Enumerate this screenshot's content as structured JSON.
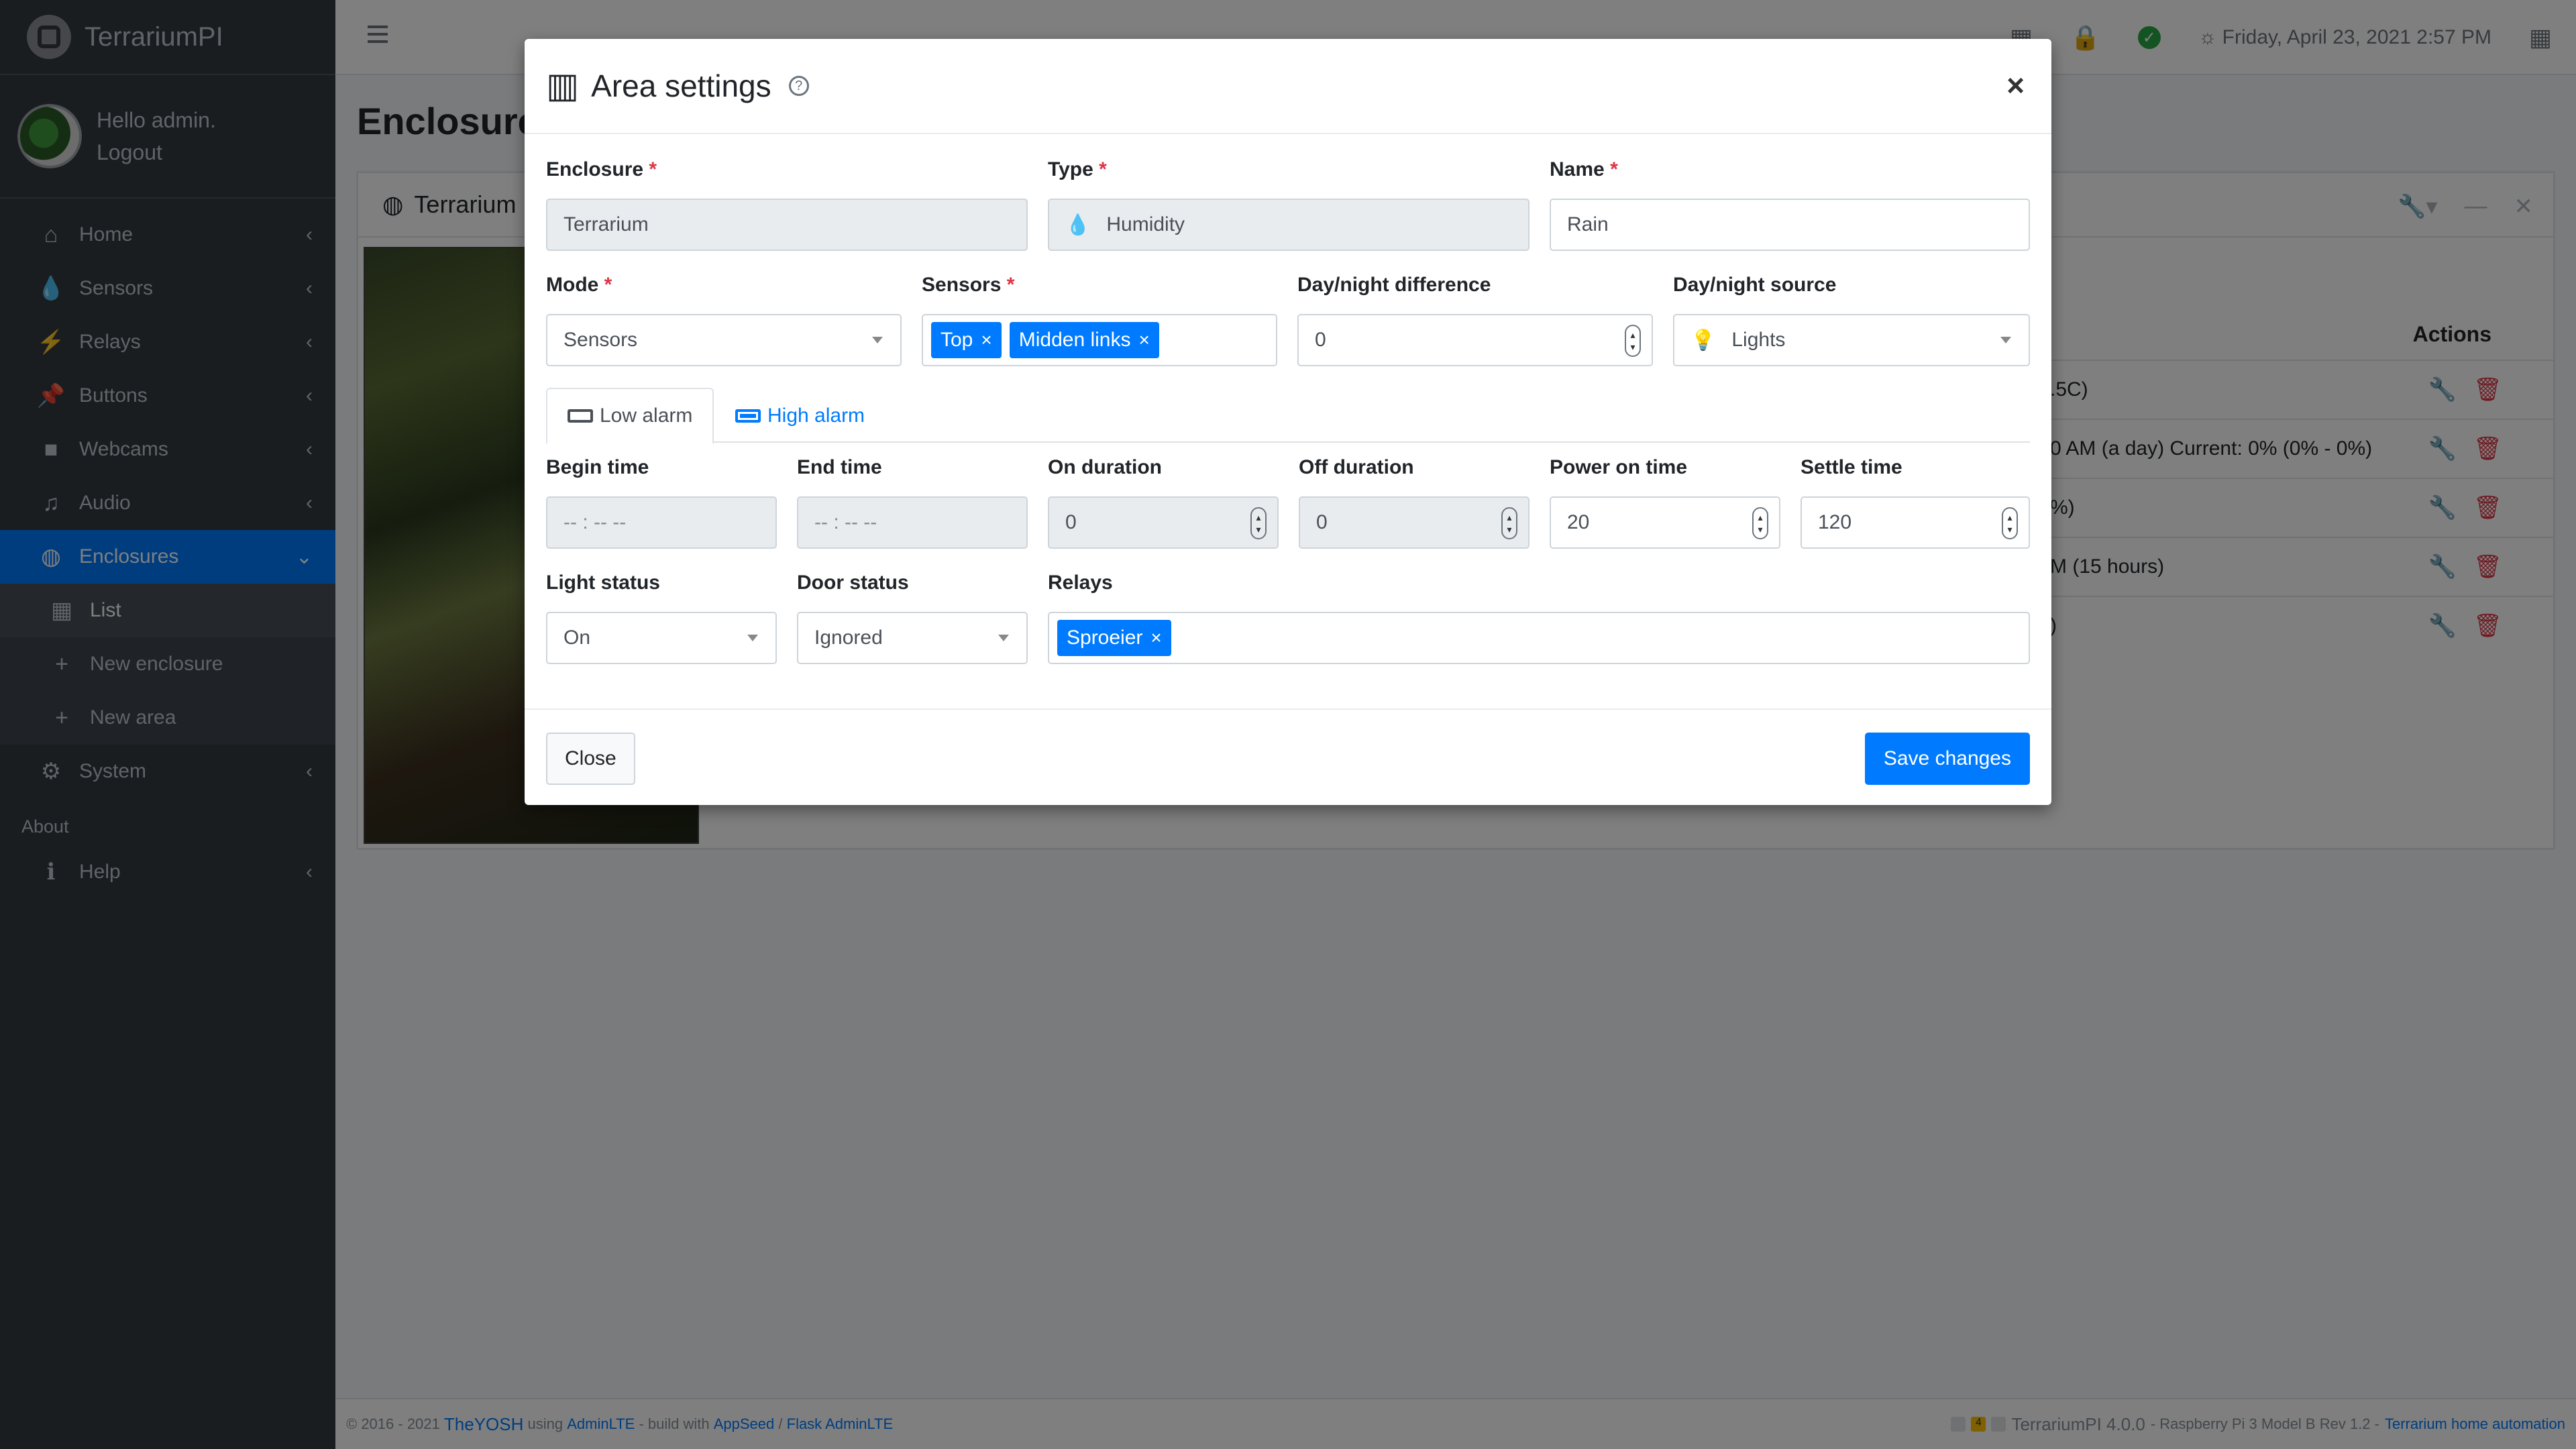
{
  "app": {
    "brand": "TerrariumPI"
  },
  "user": {
    "greeting": "Hello admin.",
    "logout": "Logout"
  },
  "sidebar": {
    "items": [
      {
        "label": "Home"
      },
      {
        "label": "Sensors"
      },
      {
        "label": "Relays"
      },
      {
        "label": "Buttons"
      },
      {
        "label": "Webcams"
      },
      {
        "label": "Audio"
      },
      {
        "label": "Enclosures"
      }
    ],
    "sub": [
      {
        "label": "List"
      },
      {
        "label": "New enclosure"
      },
      {
        "label": "New area"
      }
    ],
    "system": "System",
    "about_header": "About",
    "help": "Help"
  },
  "topbar": {
    "datetime": "Friday, April 23, 2021 2:57 PM"
  },
  "page": {
    "title": "Enclosures",
    "card_title": "Terrarium",
    "actions_header": "Actions",
    "rows": [
      ".5C)",
      "0 AM (a day)   Current: 0% (0% - 0%)",
      "%)",
      "M (15 hours)",
      ")"
    ]
  },
  "footer": {
    "copy": "© 2016 - 2021",
    "author": "TheYOSH",
    "using": "using",
    "adminlte": "AdminLTE",
    "build_with": "- build with",
    "appseed": "AppSeed",
    "sep": "/",
    "flask": "Flask AdminLTE",
    "badge_count": "4",
    "version": "TerrariumPI 4.0.0",
    "hardware": "- Raspberry Pi 3 Model B Rev 1.2 -",
    "tagline": "Terrarium home automation"
  },
  "modal": {
    "title": "Area settings",
    "enclosure": {
      "label": "Enclosure",
      "value": "Terrarium"
    },
    "type": {
      "label": "Type",
      "value": "Humidity"
    },
    "name": {
      "label": "Name",
      "value": "Rain"
    },
    "mode": {
      "label": "Mode",
      "value": "Sensors"
    },
    "sensors": {
      "label": "Sensors",
      "tags": [
        "Top",
        "Midden links"
      ]
    },
    "daynight_diff": {
      "label": "Day/night difference",
      "value": "0"
    },
    "daynight_source": {
      "label": "Day/night source",
      "value": "Lights"
    },
    "tabs": {
      "low": "Low alarm",
      "high": "High alarm"
    },
    "begin_time": {
      "label": "Begin time",
      "placeholder": "-- : --  --"
    },
    "end_time": {
      "label": "End time",
      "placeholder": "-- : --  --"
    },
    "on_duration": {
      "label": "On duration",
      "value": "0"
    },
    "off_duration": {
      "label": "Off duration",
      "value": "0"
    },
    "power_on_time": {
      "label": "Power on time",
      "value": "20"
    },
    "settle_time": {
      "label": "Settle time",
      "value": "120"
    },
    "light_status": {
      "label": "Light status",
      "value": "On"
    },
    "door_status": {
      "label": "Door status",
      "value": "Ignored"
    },
    "relays": {
      "label": "Relays",
      "tags": [
        "Sproeier"
      ]
    },
    "close_label": "Close",
    "save_label": "Save changes"
  }
}
